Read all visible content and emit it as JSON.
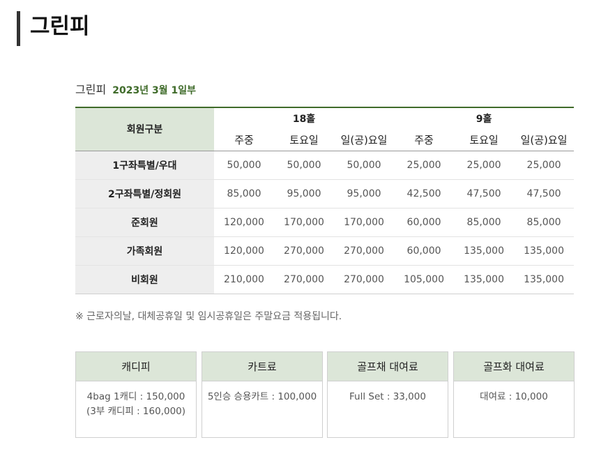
{
  "title": "그린피",
  "subtitle": {
    "label": "그린피",
    "date": "2023년 3월 1일부"
  },
  "table": {
    "member_header": "회원구분",
    "groups": [
      "18홀",
      "9홀"
    ],
    "subheaders": [
      "주중",
      "토요일",
      "일(공)요일",
      "주중",
      "토요일",
      "일(공)요일"
    ],
    "rows": [
      {
        "label": "1구좌특별/우대",
        "values": [
          "50,000",
          "50,000",
          "50,000",
          "25,000",
          "25,000",
          "25,000"
        ]
      },
      {
        "label": "2구좌특별/정회원",
        "values": [
          "85,000",
          "95,000",
          "95,000",
          "42,500",
          "47,500",
          "47,500"
        ]
      },
      {
        "label": "준회원",
        "values": [
          "120,000",
          "170,000",
          "170,000",
          "60,000",
          "85,000",
          "85,000"
        ]
      },
      {
        "label": "가족회원",
        "values": [
          "120,000",
          "270,000",
          "270,000",
          "60,000",
          "135,000",
          "135,000"
        ]
      },
      {
        "label": "비회원",
        "values": [
          "210,000",
          "270,000",
          "270,000",
          "105,000",
          "135,000",
          "135,000"
        ]
      }
    ]
  },
  "note": "※ 근로자의날, 대체공휴일 및 임시공휴일은 주말요금 적용됩니다.",
  "boxes": [
    {
      "title": "캐디피",
      "lines": [
        "4bag 1캐디 : 150,000",
        "(3부 캐디피 : 160,000)"
      ]
    },
    {
      "title": "카트료",
      "lines": [
        "5인승 승용카트 : 100,000"
      ]
    },
    {
      "title": "골프채 대여료",
      "lines": [
        "Full Set : 33,000"
      ]
    },
    {
      "title": "골프화 대여료",
      "lines": [
        "대여료 : 10,000"
      ]
    }
  ]
}
